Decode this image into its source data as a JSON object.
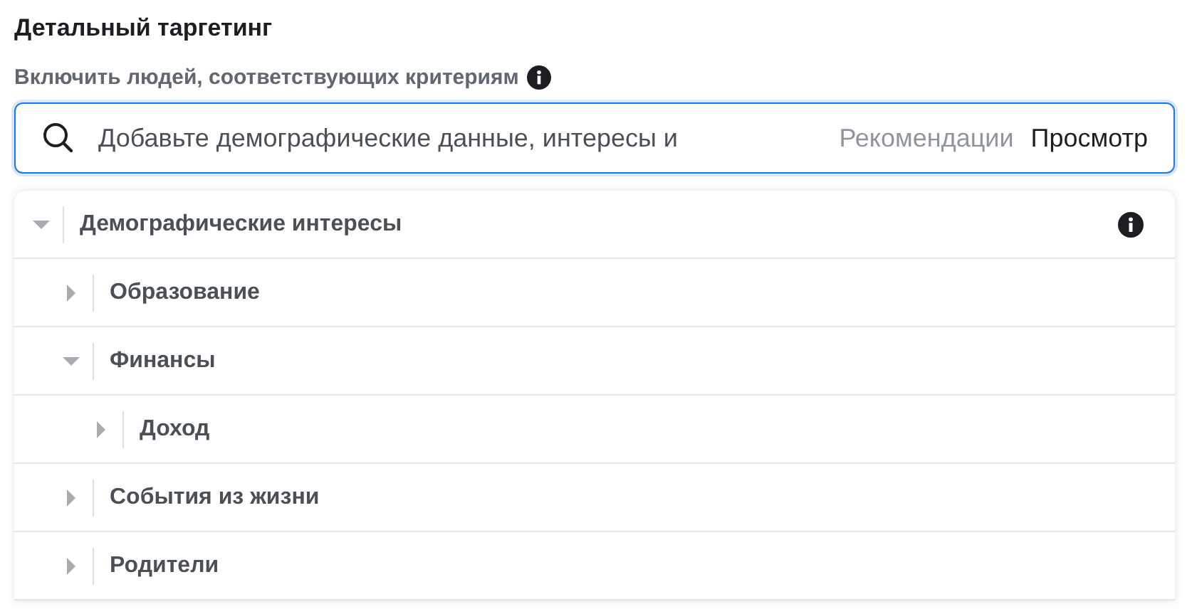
{
  "title": "Детальный таргетинг",
  "subtitle": "Включить людей, соответствующих критериям",
  "search": {
    "placeholder": "Добавьте демографические данные, интересы и"
  },
  "actions": [
    {
      "label": "Рекомендации",
      "selected": false
    },
    {
      "label": "Просмотр",
      "selected": true
    }
  ],
  "tree": [
    {
      "label": "Демографические интересы",
      "expanded": true,
      "info": true,
      "children": [
        {
          "label": "Образование",
          "expanded": false
        },
        {
          "label": "Финансы",
          "expanded": true,
          "children": [
            {
              "label": "Доход",
              "expanded": false
            }
          ]
        },
        {
          "label": "События из жизни",
          "expanded": false
        },
        {
          "label": "Родители",
          "expanded": false
        }
      ]
    }
  ]
}
